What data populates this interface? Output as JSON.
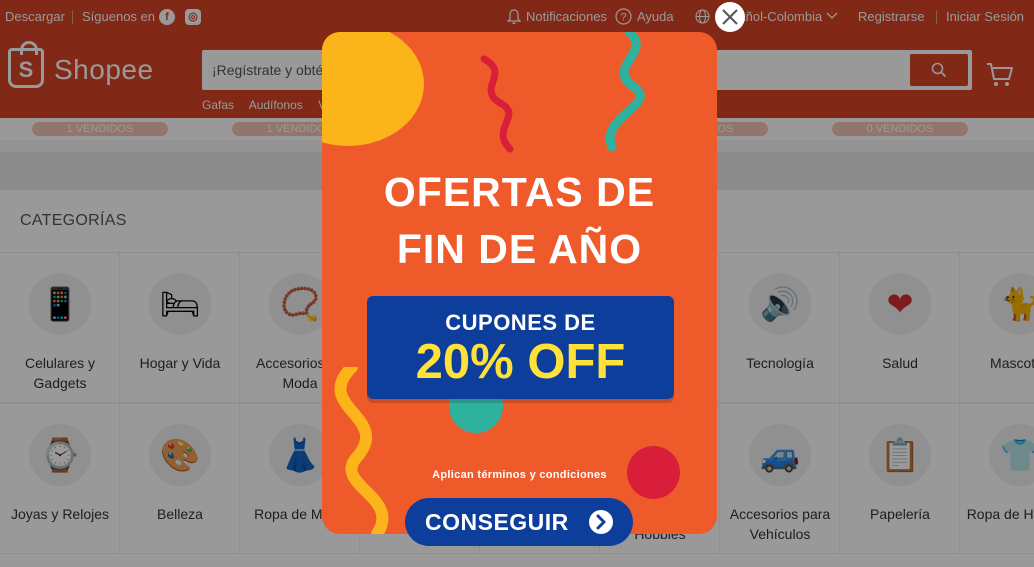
{
  "topbar": {
    "download": "Descargar",
    "follow": "Síguenos en",
    "notifications": "Notificaciones",
    "help": "Ayuda",
    "language": "Español-Colombia",
    "register": "Registrarse",
    "login": "Iniciar Sesión"
  },
  "header": {
    "logo_text": "Shopee",
    "search_placeholder": "¡Regístrate y obtén...",
    "hints": [
      "Gafas",
      "Audífonos",
      "V"
    ]
  },
  "sold_strip": [
    "1 VENDIDOS",
    "1 VENDIDOS",
    "1 VENDIDOS",
    "0 VENDIDOS"
  ],
  "categories": {
    "title": "CATEGORÍAS",
    "items": [
      {
        "label": "Celulares y Gadgets",
        "icon": "phone-icon"
      },
      {
        "label": "Hogar y Vida",
        "icon": "pillow-icon"
      },
      {
        "label": "Accesorios de Moda",
        "icon": "bracelet-icon"
      },
      {
        "label": "",
        "icon": ""
      },
      {
        "label": "",
        "icon": ""
      },
      {
        "label": "",
        "icon": ""
      },
      {
        "label": "Tecnología",
        "icon": "speaker-icon"
      },
      {
        "label": "Salud",
        "icon": "heart-icon"
      },
      {
        "label": "Mascotas",
        "icon": "cat-icon"
      },
      {
        "label": "Joyas y Relojes",
        "icon": "watch-icon"
      },
      {
        "label": "Belleza",
        "icon": "palette-icon"
      },
      {
        "label": "Ropa de Mujer",
        "icon": "dress-icon"
      },
      {
        "label": "",
        "icon": ""
      },
      {
        "label": "Hobbies",
        "icon": ""
      },
      {
        "label": "",
        "icon": ""
      },
      {
        "label": "Accesorios para Vehículos",
        "icon": "car-icon"
      },
      {
        "label": "Papelería",
        "icon": "clipboard-icon"
      },
      {
        "label": "Ropa de Hombre",
        "icon": "shirt-icon"
      }
    ]
  },
  "popup": {
    "title_line1": "OFERTAS DE",
    "title_line2": "FIN DE AÑO",
    "coupon_line1": "CUPONES DE",
    "coupon_line2": "20% OFF",
    "terms": "Aplican términos y condiciones",
    "cta": "CONSEGUIR"
  },
  "colors": {
    "brand": "#d84426",
    "popup_bg": "#ef5a2b",
    "coupon_bg": "#0d3e9c",
    "coupon_accent": "#ffe13a"
  }
}
